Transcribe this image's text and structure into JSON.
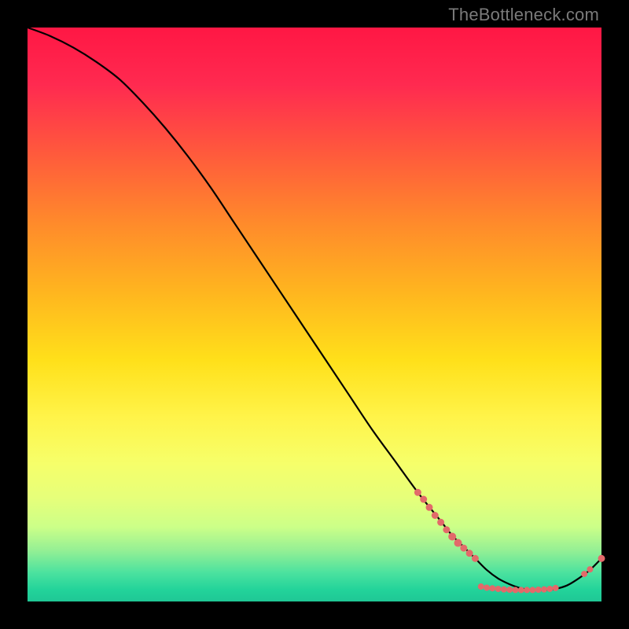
{
  "attribution": "TheBottleneck.com",
  "colors": {
    "marker": "#e26a6a",
    "curve": "#000000"
  },
  "chart_data": {
    "type": "line",
    "title": "",
    "xlabel": "",
    "ylabel": "",
    "xlim": [
      0,
      100
    ],
    "ylim": [
      0,
      100
    ],
    "series": [
      {
        "name": "bottleneck-curve",
        "x": [
          0,
          4,
          8,
          12,
          16,
          20,
          24,
          28,
          32,
          36,
          40,
          44,
          48,
          52,
          56,
          60,
          64,
          68,
          72,
          74,
          76,
          78,
          80,
          82,
          84,
          86,
          88,
          90,
          92,
          94,
          96,
          98,
          100
        ],
        "y": [
          100,
          98.5,
          96.5,
          94,
          91,
          87,
          82.5,
          77.5,
          72,
          66,
          60,
          54,
          48,
          42,
          36,
          30,
          24.5,
          19,
          14,
          11.5,
          9.5,
          7.5,
          5.5,
          4,
          3,
          2.3,
          2,
          2,
          2.2,
          2.8,
          4,
          5.5,
          7.5
        ]
      },
      {
        "name": "marker-points",
        "points": [
          {
            "x": 68,
            "y": 19,
            "r": 4
          },
          {
            "x": 69,
            "y": 17.8,
            "r": 4
          },
          {
            "x": 70,
            "y": 16.4,
            "r": 4
          },
          {
            "x": 71,
            "y": 15,
            "r": 4
          },
          {
            "x": 72,
            "y": 13.8,
            "r": 4
          },
          {
            "x": 73,
            "y": 12.5,
            "r": 4
          },
          {
            "x": 74,
            "y": 11.3,
            "r": 4.5
          },
          {
            "x": 75,
            "y": 10.2,
            "r": 4.5
          },
          {
            "x": 76,
            "y": 9.3,
            "r": 4
          },
          {
            "x": 77,
            "y": 8.4,
            "r": 4
          },
          {
            "x": 78,
            "y": 7.5,
            "r": 4
          },
          {
            "x": 79,
            "y": 2.6,
            "r": 3.5
          },
          {
            "x": 80,
            "y": 2.4,
            "r": 3.5
          },
          {
            "x": 81,
            "y": 2.3,
            "r": 3.5
          },
          {
            "x": 82,
            "y": 2.2,
            "r": 3.5
          },
          {
            "x": 83,
            "y": 2.1,
            "r": 3.5
          },
          {
            "x": 84,
            "y": 2.05,
            "r": 3.5
          },
          {
            "x": 85,
            "y": 2.0,
            "r": 3.5
          },
          {
            "x": 86,
            "y": 2.0,
            "r": 3.5
          },
          {
            "x": 87,
            "y": 2.0,
            "r": 3.5
          },
          {
            "x": 88,
            "y": 2.0,
            "r": 3.5
          },
          {
            "x": 89,
            "y": 2.05,
            "r": 3.5
          },
          {
            "x": 90,
            "y": 2.1,
            "r": 3.5
          },
          {
            "x": 91,
            "y": 2.2,
            "r": 3.5
          },
          {
            "x": 92,
            "y": 2.35,
            "r": 3.5
          },
          {
            "x": 97,
            "y": 4.8,
            "r": 3.5
          },
          {
            "x": 98,
            "y": 5.6,
            "r": 3.5
          },
          {
            "x": 100,
            "y": 7.5,
            "r": 4
          }
        ]
      }
    ]
  }
}
